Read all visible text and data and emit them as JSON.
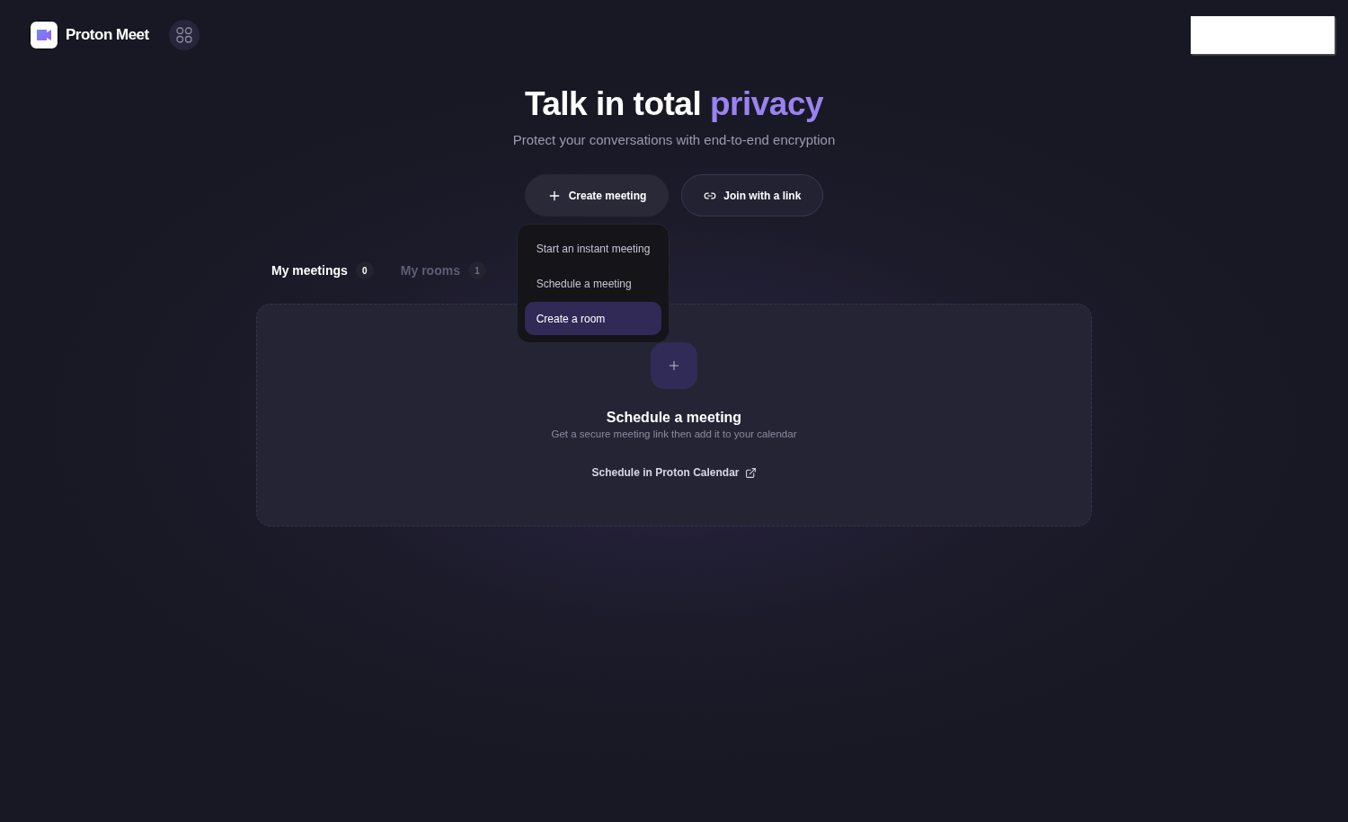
{
  "header": {
    "brand": "Proton Meet"
  },
  "hero": {
    "title": "Talk in total",
    "highlight": "privacy",
    "subtitle": "Protect your conversations with end-to-end encryption"
  },
  "actions": [
    {
      "kind": "create",
      "label": "Create meeting"
    },
    {
      "kind": "join",
      "label": "Join with a link"
    }
  ],
  "menu": {
    "open": true,
    "items": [
      {
        "label": "Start an instant meeting",
        "selected": false
      },
      {
        "label": "Schedule a meeting",
        "selected": false
      },
      {
        "label": "Create a room",
        "selected": true
      }
    ]
  },
  "tabs": [
    {
      "label": "My meetings",
      "count": "0",
      "selected": true
    },
    {
      "label": "My rooms",
      "count": "1",
      "selected": false
    }
  ],
  "empty_state": {
    "title": "Schedule a meeting",
    "description": "Get a secure meeting link then add it to your calendar",
    "link": "Schedule in Proton Calendar"
  }
}
